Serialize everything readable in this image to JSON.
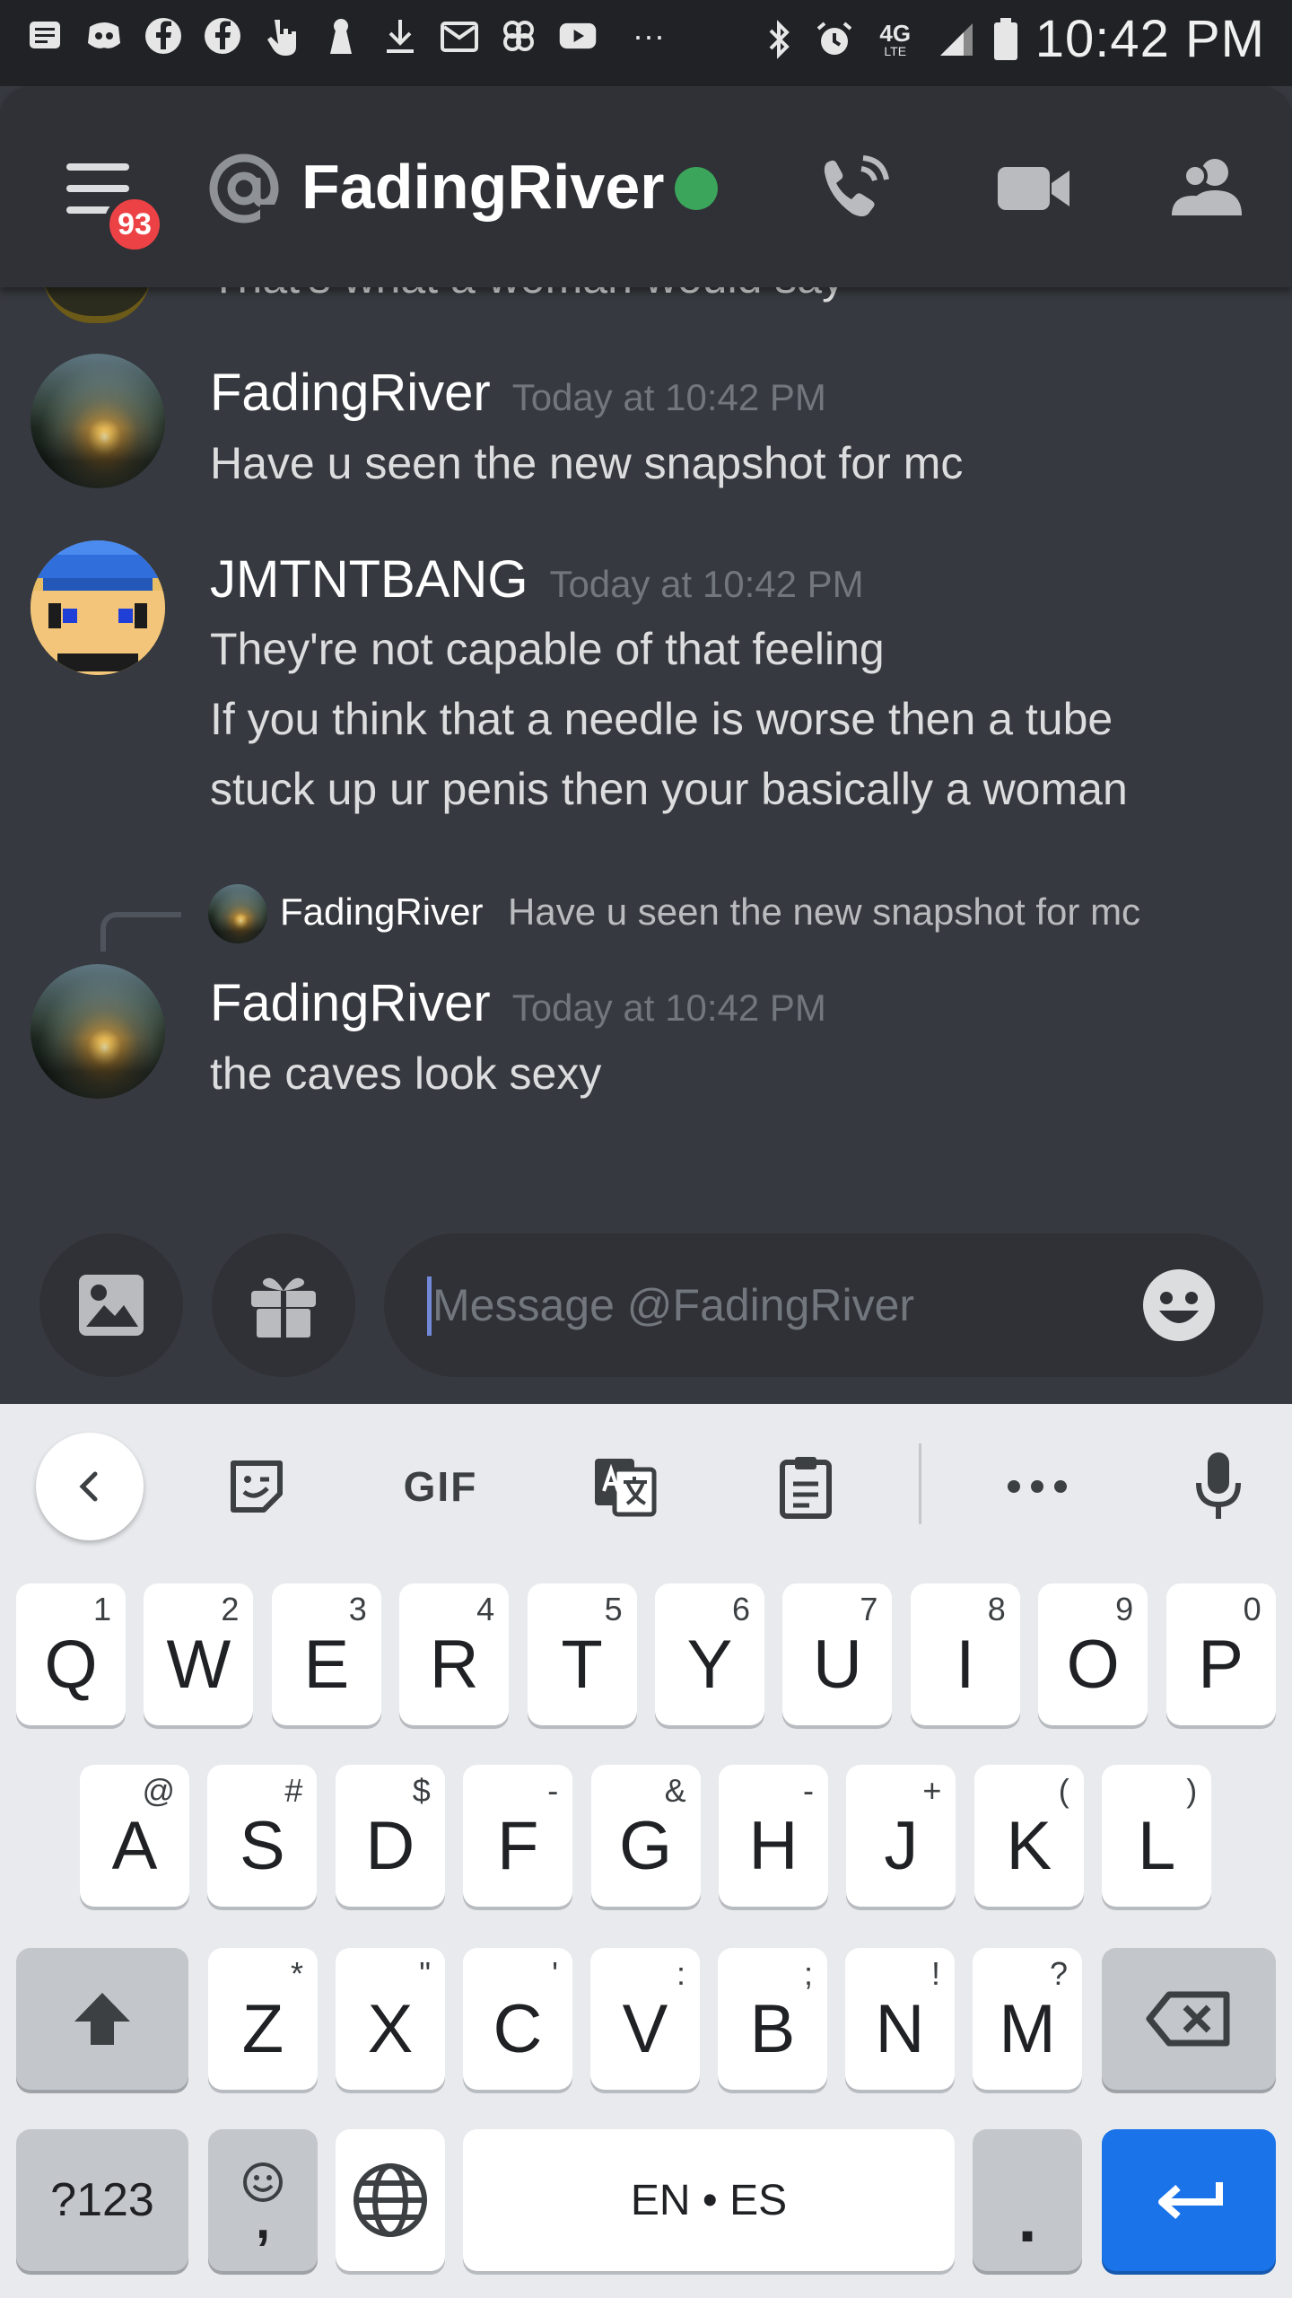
{
  "status_bar": {
    "time": "10:42 PM",
    "network_label": "4G",
    "network_sub": "LTE",
    "more_label": "···"
  },
  "header": {
    "unread_badge": "93",
    "dm_name": "FadingRiver",
    "presence": "online",
    "colors": {
      "online": "#3ba55c",
      "badge": "#ed4245"
    }
  },
  "messages": {
    "partial_text": "That's what a woman would say",
    "items": [
      {
        "author": "FadingRiver",
        "timestamp": "Today at 10:42 PM",
        "lines": [
          "Have u seen the new snapshot for mc"
        ],
        "avatar": "sunset-avatar"
      },
      {
        "author": "JMTNTBANG",
        "timestamp": "Today at 10:42 PM",
        "lines": [
          "They're not capable of that feeling",
          "If you think that a needle is worse then a tube",
          "stuck up ur penis then your basically a woman"
        ],
        "avatar": "pixel-avatar"
      },
      {
        "author": "FadingRiver",
        "timestamp": "Today at 10:42 PM",
        "lines": [
          "the caves look sexy"
        ],
        "avatar": "sunset-avatar",
        "reply": {
          "author": "FadingRiver",
          "text": "Have u seen the new snapshot for mc"
        }
      }
    ]
  },
  "composer": {
    "placeholder": "Message @FadingRiver"
  },
  "keyboard": {
    "toolbar": {
      "gif_label": "GIF"
    },
    "row1": [
      {
        "key": "Q",
        "hint": "1"
      },
      {
        "key": "W",
        "hint": "2"
      },
      {
        "key": "E",
        "hint": "3"
      },
      {
        "key": "R",
        "hint": "4"
      },
      {
        "key": "T",
        "hint": "5"
      },
      {
        "key": "Y",
        "hint": "6"
      },
      {
        "key": "U",
        "hint": "7"
      },
      {
        "key": "I",
        "hint": "8"
      },
      {
        "key": "O",
        "hint": "9"
      },
      {
        "key": "P",
        "hint": "0"
      }
    ],
    "row2": [
      {
        "key": "A",
        "hint": "@"
      },
      {
        "key": "S",
        "hint": "#"
      },
      {
        "key": "D",
        "hint": "$"
      },
      {
        "key": "F",
        "hint": "-"
      },
      {
        "key": "G",
        "hint": "&"
      },
      {
        "key": "H",
        "hint": "-"
      },
      {
        "key": "J",
        "hint": "+"
      },
      {
        "key": "K",
        "hint": "("
      },
      {
        "key": "L",
        "hint": ")"
      }
    ],
    "row3": [
      {
        "key": "Z",
        "hint": "*"
      },
      {
        "key": "X",
        "hint": "\""
      },
      {
        "key": "C",
        "hint": "'"
      },
      {
        "key": "V",
        "hint": ":"
      },
      {
        "key": "B",
        "hint": ";"
      },
      {
        "key": "N",
        "hint": "!"
      },
      {
        "key": "M",
        "hint": "?"
      }
    ],
    "symbols_label": "?123",
    "comma_label": ",",
    "space_label": "EN • ES",
    "period_label": "."
  }
}
